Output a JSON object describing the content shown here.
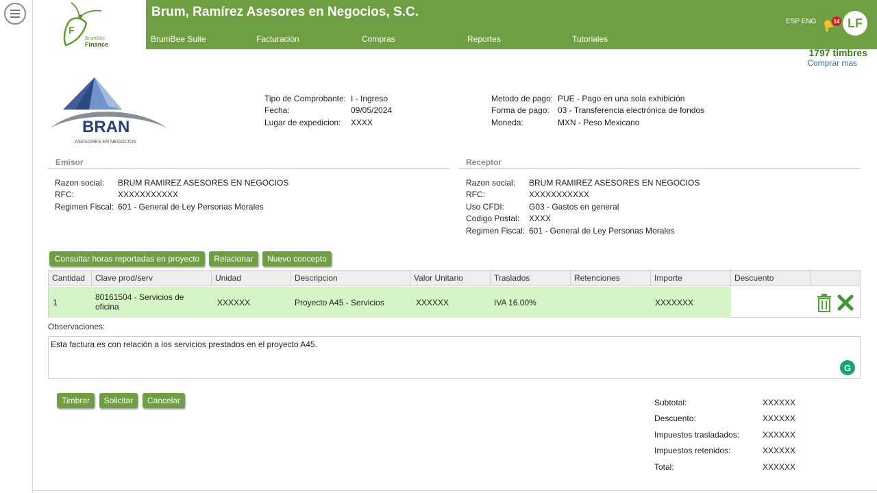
{
  "header": {
    "company": "Brum, Ramírez Asesores en Negocios, S.C.",
    "nav": [
      "BrumBee Suite",
      "Facturación",
      "Compras",
      "Reportes",
      "Tutoriales"
    ],
    "lang": "ESP ENG",
    "notifications": "14",
    "avatar": "LF",
    "brand_line1": "BrumBee",
    "brand_line2": "Finance",
    "logo_letter": "F"
  },
  "stamps": {
    "count": "1797 timbres",
    "buy": "Comprar mas"
  },
  "logo": {
    "name": "BRAN",
    "subtitle": "ASESORES EN NEGOCIOS"
  },
  "invoice": {
    "left": [
      {
        "label": "Tipo de Comprobante:",
        "value": "I - Ingreso"
      },
      {
        "label": "Fecha:",
        "value": "09/05/2024"
      },
      {
        "label": "Lugar de expedicion:",
        "value": "XXXX"
      }
    ],
    "right": [
      {
        "label": "Metodo de pago:",
        "value": "PUE - Pago en una sola exhibición"
      },
      {
        "label": "Forma de pago:",
        "value": "03 - Transferencia electrónica de fondos"
      },
      {
        "label": "Moneda:",
        "value": "MXN - Peso Mexicano"
      }
    ]
  },
  "emisor": {
    "title": "Emisor",
    "rows": [
      {
        "label": "Razon social:",
        "value": "BRUM RAMIREZ ASESORES EN NEGOCIOS"
      },
      {
        "label": "RFC:",
        "value": "XXXXXXXXXXX"
      },
      {
        "label": "Regimen Fiscal:",
        "value": "601 - General de Ley Personas Morales"
      }
    ]
  },
  "receptor": {
    "title": "Receptor",
    "rows": [
      {
        "label": "Razon social:",
        "value": "BRUM RAMIREZ ASESORES EN NEGOCIOS"
      },
      {
        "label": "RFC:",
        "value": "XXXXXXXXXXX"
      },
      {
        "label": "Uso CFDI:",
        "value": "G03 - Gastos en general"
      },
      {
        "label": "Codigo Postal:",
        "value": "XXXX"
      },
      {
        "label": "Regimen Fiscal:",
        "value": "601 - General de Ley Personas Morales"
      }
    ]
  },
  "actions": {
    "consultar": "Consultar horas reportadas en proyecto",
    "relacionar": "Relacionar",
    "nuevo": "Nuevo concepto"
  },
  "table": {
    "headers": [
      "Cantidad",
      "Clave prod/serv",
      "Unidad",
      "Descripcion",
      "Valor Unitario",
      "Traslados",
      "Retenciones",
      "Importe",
      "Descuento"
    ],
    "row": {
      "cantidad": "1",
      "clave_line1": "80161504 - Servicios de",
      "clave_line2": "oficina",
      "unidad": "XXXXXX",
      "descripcion": "Proyecto A45 - Servicios",
      "valor": "XXXXXX",
      "traslados": "IVA 16.00%",
      "retenciones": "",
      "importe": "XXXXXXX",
      "descuento": ""
    }
  },
  "observaciones": {
    "label": "Observaciones:",
    "text": "Esta factura es con relación a los servicios prestados en el proyecto A45."
  },
  "footer_buttons": {
    "timbrar": "Timbrar",
    "solicitar": "Solicitar",
    "cancelar": "Cancelar"
  },
  "totals": [
    {
      "label": "Subtotal:",
      "value": "XXXXXX"
    },
    {
      "label": "Descuento:",
      "value": "XXXXXX"
    },
    {
      "label": "Impuestos trasladados:",
      "value": "XXXXXX"
    },
    {
      "label": "Impuestos retenidos:",
      "value": "XXXXXX"
    },
    {
      "label": "Total:",
      "value": "XXXXXX"
    }
  ],
  "colors": {
    "brand_green": "#6ea043",
    "row_green": "#d6f5c6",
    "link_blue": "#2a74a8"
  },
  "icons": [
    "hamburger-menu-icon",
    "bell-icon",
    "trash-icon",
    "close-icon",
    "grammarly-icon"
  ]
}
